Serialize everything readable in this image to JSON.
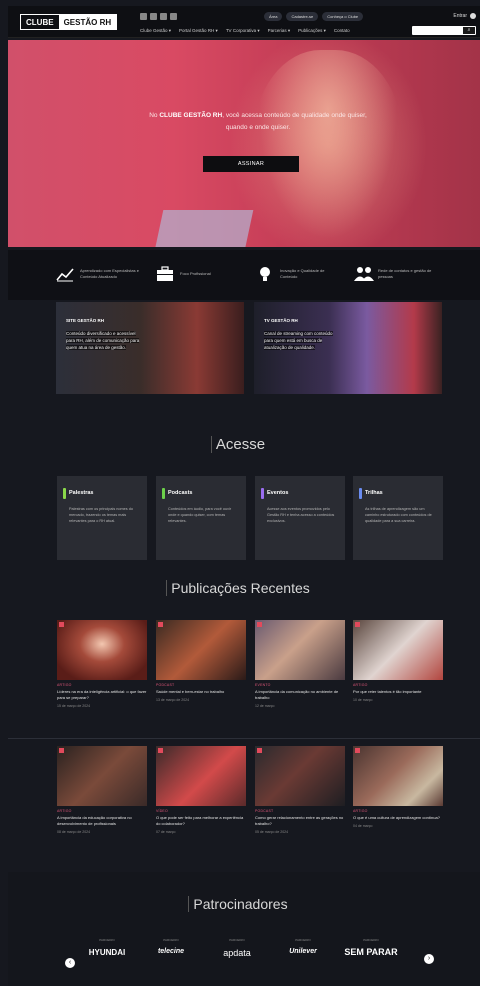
{
  "header": {
    "logo_left": "CLUBE",
    "logo_right": "GESTÃO RH",
    "pills": [
      "Área",
      "Cadastre-se",
      "Conheça o Clube"
    ],
    "enter_label": "Entrar",
    "nav": [
      "Clube Gestão ▾",
      "Portal Gestão RH ▾",
      "TV Corporativa ▾",
      "Parcerias ▾",
      "Publicações ▾",
      "Contato"
    ],
    "search_placeholder": "",
    "search_icon": "search-icon"
  },
  "hero": {
    "line1_prefix": "No ",
    "line1_brand": "CLUBE GESTÃO RH",
    "line1_suffix": ", você acessa conteúdo de qualidade onde quiser,",
    "line2": "quando e onde quiser.",
    "cta": "ASSINAR"
  },
  "features": [
    {
      "icon": "chart-line-icon",
      "text": "Aprendizado com Especialistas e Conteúdo Atualizado"
    },
    {
      "icon": "briefcase-icon",
      "text": "Foco Profissional"
    },
    {
      "icon": "lightbulb-icon",
      "text": "Inovação e Qualidade de Conteúdo"
    },
    {
      "icon": "people-icon",
      "text": "Rede de contatos e gestão de pessoas"
    }
  ],
  "media_cards": [
    {
      "title": "SITE GESTÃO RH",
      "text": "Conteúdo diversificado e acessível para RH, além de comunicação para quem atua na área de gestão."
    },
    {
      "title": "TV GESTÃO RH",
      "text": "Canal de streaming com conteúdo para quem está em busca de atualização de qualidade."
    }
  ],
  "access": {
    "title": "Acesse",
    "items": [
      {
        "color": "#8bd94a",
        "title": "Palestras",
        "text": "Palestras com os principais nomes do mercado, trazendo os temas mais relevantes para o RH atual."
      },
      {
        "color": "#6cd04a",
        "title": "Podcasts",
        "text": "Conteúdos em áudio, para você ouvir onde e quando quiser, com temas relevantes."
      },
      {
        "color": "#9b6ef0",
        "title": "Eventos",
        "text": "Acesse aos eventos promovidos pelo Gestão RH e tenha acesso a conteúdos exclusivos."
      },
      {
        "color": "#6a8cf0",
        "title": "Trilhas",
        "text": "As trilhas de aprendizagem são um caminho estruturado com conteúdos de qualidade para a sua carreira."
      }
    ]
  },
  "publications": {
    "title": "Publicações Recentes",
    "row1": [
      {
        "cat": "ARTIGO",
        "title": "Líderes na era da inteligência artificial: o que fazer para se preparar?",
        "date": "15 de março de 2024",
        "img": "#7a2a22"
      },
      {
        "cat": "PODCAST",
        "title": "Saúde mental e bem-estar no trabalho",
        "date": "13 de março de 2024",
        "img": "#6b3b28"
      },
      {
        "cat": "EVENTO",
        "title": "A importância da comunicação no ambiente de trabalho",
        "date": "12 de março",
        "img": "#4a4250"
      },
      {
        "cat": "ARTIGO",
        "title": "Por que reter talentos é tão importante",
        "date": "10 de março",
        "img": "#5a4640"
      }
    ],
    "row2": [
      {
        "cat": "ARTIGO",
        "title": "A importância da educação corporativa no desenvolvimento de profissionais",
        "date": "08 de março de 2024",
        "img": "#4a3430"
      },
      {
        "cat": "VÍDEO",
        "title": "O que pode ser feito para melhorar a experiência do colaborador?",
        "date": "07 de março",
        "img": "#8a3a3a"
      },
      {
        "cat": "PODCAST",
        "title": "Como gerar relacionamento entre as gerações no trabalho?",
        "date": "05 de março de 2024",
        "img": "#3e3a3a"
      },
      {
        "cat": "ARTIGO",
        "title": "O que é uma cultura de aprendizagem contínua?",
        "date": "04 de março",
        "img": "#5a3a33"
      }
    ]
  },
  "sponsors": {
    "title": "Patrocinadores",
    "items": [
      {
        "label": "PARCEIRO",
        "name": "HYUNDAI"
      },
      {
        "label": "PARCEIRO",
        "name": "telecine"
      },
      {
        "label": "PARCEIRO",
        "name": "apdata"
      },
      {
        "label": "PARCEIRO",
        "name": "Unilever"
      },
      {
        "label": "PARCEIRO",
        "name": "SEM PARAR"
      }
    ]
  }
}
